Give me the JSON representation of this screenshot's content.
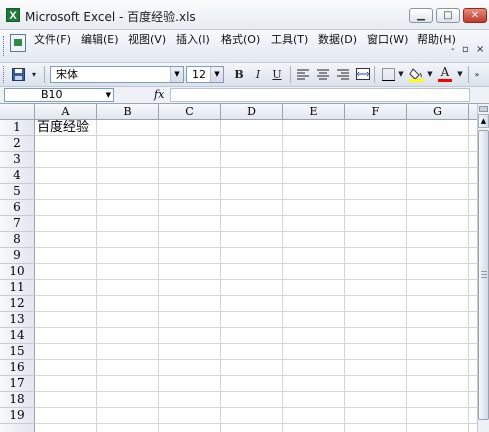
{
  "window": {
    "title": "Microsoft Excel - 百度经验.xls",
    "app_icon_letter": "X",
    "controls": {
      "minimize": "▁",
      "restore": "□",
      "close": "✕"
    }
  },
  "menubar": {
    "items": [
      "文件(F)",
      "编辑(E)",
      "视图(V)",
      "插入(I)",
      "格式(O)",
      "工具(T)",
      "数据(D)",
      "窗口(W)",
      "帮助(H)"
    ],
    "doc_controls": {
      "minimize": "-",
      "restore": "▫",
      "close": "×"
    }
  },
  "toolbar": {
    "font_name": "宋体",
    "font_size": "12",
    "bold": "B",
    "italic": "I",
    "underline": "U",
    "font_color_letter": "A",
    "fill_color": "#ffff00",
    "font_color": "#ff0000"
  },
  "formula_bar": {
    "name_box": "B10",
    "fx": "fx",
    "formula": ""
  },
  "sheet": {
    "columns": [
      "A",
      "B",
      "C",
      "D",
      "E",
      "F",
      "G"
    ],
    "rows": [
      "1",
      "2",
      "3",
      "4",
      "5",
      "6",
      "7",
      "8",
      "9",
      "10",
      "11",
      "12",
      "13",
      "14",
      "15",
      "16",
      "17",
      "18",
      "19"
    ],
    "cells": {
      "A1": "百度经验"
    }
  }
}
